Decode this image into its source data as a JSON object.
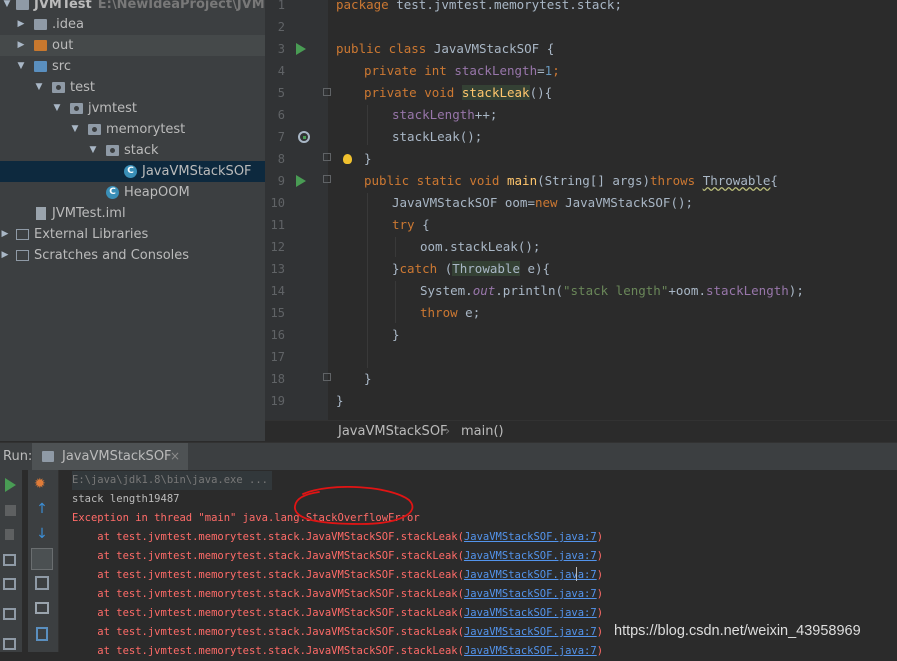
{
  "project_tree": {
    "root": {
      "label": "JVMTest",
      "path": "E:\\NewIdeaProject\\JVMTest"
    },
    "items": [
      {
        "label": "JVMTest"
      },
      {
        "label": ".idea"
      },
      {
        "label": "out"
      },
      {
        "label": "src"
      },
      {
        "label": "test"
      },
      {
        "label": "jvmtest"
      },
      {
        "label": "memorytest"
      },
      {
        "label": "stack"
      },
      {
        "label": "JavaVMStackSOF"
      },
      {
        "label": "HeapOOM"
      },
      {
        "label": "JVMTest.iml"
      },
      {
        "label": "External Libraries"
      },
      {
        "label": "Scratches and Consoles"
      }
    ]
  },
  "editor": {
    "line_numbers": [
      "1",
      "2",
      "3",
      "4",
      "5",
      "6",
      "7",
      "8",
      "9",
      "10",
      "11",
      "12",
      "13",
      "14",
      "15",
      "16",
      "17",
      "18",
      "19"
    ],
    "code": {
      "l1_kw": "package",
      "l1_rest": " test.jvmtest.memorytest.stack;",
      "l3_kw": "public class",
      "l3_rest": " JavaVMStackSOF {",
      "l4_kw": "private int",
      "l4_field": "stackLength",
      "l4_eq": "=",
      "l4_num": "1",
      "l4_semi": ";",
      "l5_kw": "private void",
      "l5_fn": "stackLeak",
      "l5_rest": "(){",
      "l6_field": "stackLength",
      "l6_rest": "++;",
      "l7_text": "stackLeak();",
      "l8_text": "}",
      "l9_kw": "public static void",
      "l9_fn": "main",
      "l9_mid": "(String[] args)",
      "l9_kw2": "throws",
      "l9_warn": "Throwable",
      "l9_end": "{",
      "l10_a": "JavaVMStackSOF oom=",
      "l10_kw": "new",
      "l10_b": " JavaVMStackSOF();",
      "l11_kw": "try",
      "l11_rest": " {",
      "l12_text": "oom.stackLeak();",
      "l13_a": "}",
      "l13_kw": "catch",
      "l13_b": " (",
      "l13_hl": "Throwable",
      "l13_c": " e){",
      "l14_a": "System.",
      "l14_out": "out",
      "l14_b": ".println(",
      "l14_str": "\"stack length\"",
      "l14_c": "+oom.",
      "l14_field": "stackLength",
      "l14_d": ");",
      "l15_kw": "throw",
      "l15_rest": " e;",
      "l16_text": "}",
      "l18_text": "}",
      "l19_text": "}"
    }
  },
  "breadcrumb": {
    "items": [
      "JavaVMStackSOF",
      "main()"
    ],
    "separator": "›"
  },
  "run_panel": {
    "label": "Run:",
    "tab_label": "JavaVMStackSOF",
    "tab_close": "×",
    "console": {
      "command": "E:\\java\\jdk1.8\\bin\\java.exe ...",
      "stdout": "stack length19487",
      "exception": "Exception in thread \"main\" java.lang.StackOverflowError",
      "trace_prefix": "    at test.jvmtest.memorytest.stack.JavaVMStackSOF.stackLeak(",
      "trace_link": "JavaVMStackSOF.java:7",
      "trace_suffix": ")",
      "trace_count": 7
    }
  },
  "watermark": "https://blog.csdn.net/weixin_43958969",
  "colors": {
    "keyword": "#cc7832",
    "field": "#9876aa",
    "number": "#6897bb",
    "method": "#ffc66d",
    "string": "#6a8759",
    "error": "#ff6b68",
    "link": "#5394ec",
    "annotation_circle": "#e01414"
  },
  "icons": [
    "folder-icon",
    "package-icon",
    "class-icon",
    "module-file-icon",
    "library-icon",
    "run-icon",
    "stop-icon",
    "rerun-icon",
    "scroll-up-icon",
    "scroll-down-icon",
    "soft-wrap-icon",
    "print-icon",
    "trash-icon",
    "lightbulb-icon",
    "recursion-icon",
    "fold-icon"
  ]
}
